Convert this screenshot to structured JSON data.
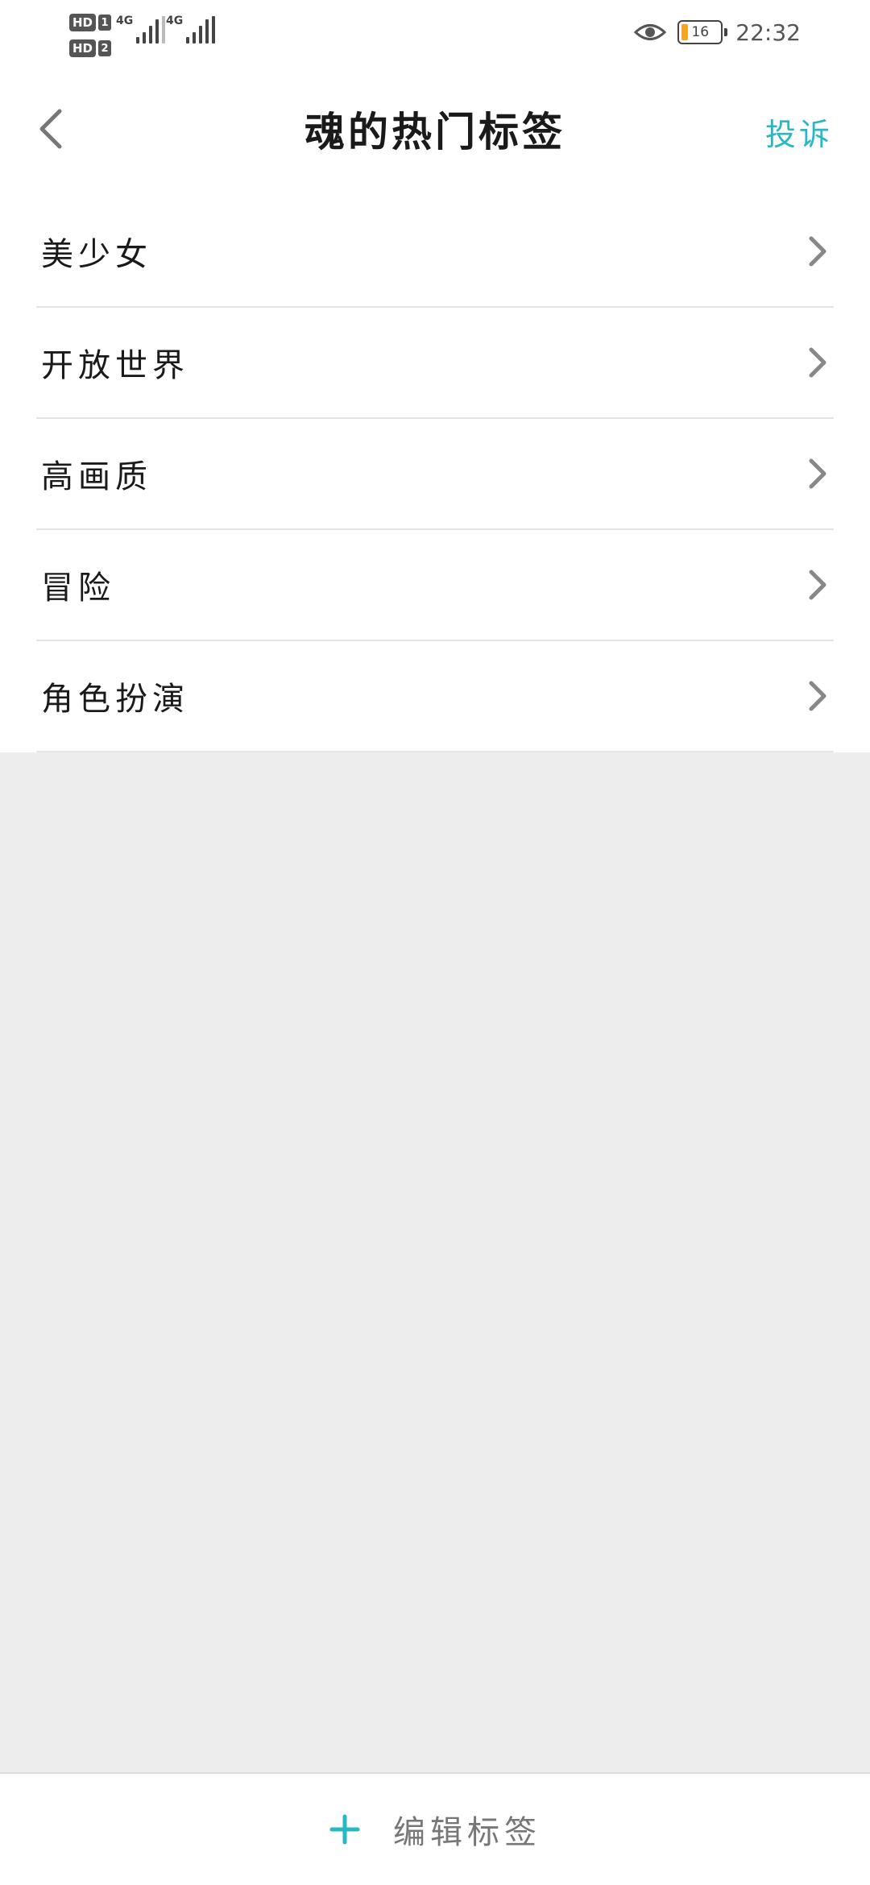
{
  "status_bar": {
    "sim1_badge": "HD",
    "sim1_num": "1",
    "sim2_badge": "HD",
    "sim2_num": "2",
    "net1": "4G",
    "net2": "4G",
    "battery_level": "16",
    "battery_color": "#f5a623",
    "time": "22:32",
    "eye_icon": "eye-icon"
  },
  "header": {
    "title": "魂的热门标签",
    "complain_label": "投诉",
    "back_icon": "chevron-left-icon",
    "accent_color": "#26b8c4"
  },
  "tags": [
    {
      "label": "美少女"
    },
    {
      "label": "开放世界"
    },
    {
      "label": "高画质"
    },
    {
      "label": "冒险"
    },
    {
      "label": "角色扮演"
    }
  ],
  "bottom_bar": {
    "icon": "plus-icon",
    "label": "编辑标签"
  }
}
